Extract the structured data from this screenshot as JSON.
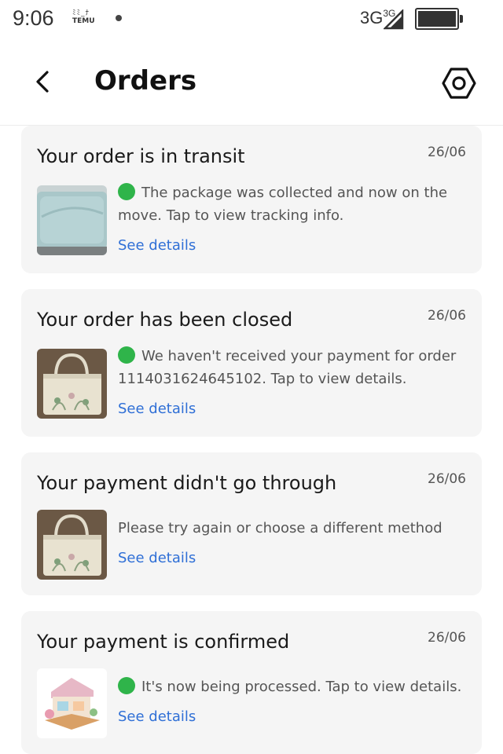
{
  "status_bar": {
    "time": "9:06",
    "app_badge_top": "ﾐﾐ_ﾅ",
    "app_badge_bottom": "TEMU",
    "network": "3G",
    "network_sup": "3G",
    "battery_level": 1.0
  },
  "header": {
    "title": "Orders",
    "back_icon": "chevron-left-icon",
    "settings_icon": "hexagon-settings-icon"
  },
  "orders": [
    {
      "title": "Your order is in transit",
      "date": "26/06",
      "status_dot": true,
      "message": "The package was collected and now on the move. Tap to view tracking info.",
      "link": "See details",
      "thumbnail": "light-blue-bag"
    },
    {
      "title": "Your order has been closed",
      "date": "26/06",
      "status_dot": true,
      "message": "We haven't received your payment for order 1114031624645102. Tap to view details.",
      "link": "See details",
      "thumbnail": "beige-tote-bag"
    },
    {
      "title": "Your payment didn't go through",
      "date": "26/06",
      "status_dot": false,
      "message": "Please try again or choose a different method",
      "link": "See details",
      "thumbnail": "beige-tote-bag"
    },
    {
      "title": "Your payment is confirmed",
      "date": "26/06",
      "status_dot": true,
      "message": "It's now being processed. Tap to view details.",
      "link": "See details",
      "thumbnail": "miniature-house"
    }
  ],
  "colors": {
    "link": "#2f6fd6",
    "status_dot": "#2fb44a",
    "card_bg": "#f5f5f5"
  }
}
